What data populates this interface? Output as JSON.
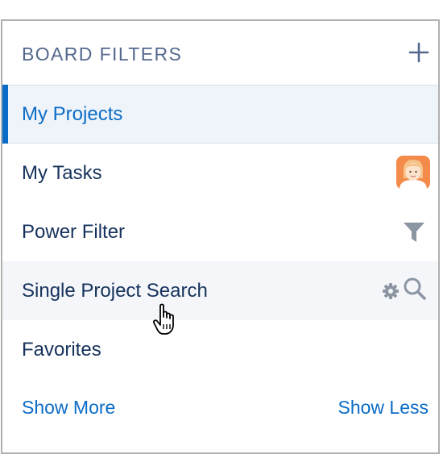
{
  "header": {
    "title": "BOARD FILTERS",
    "add_icon": "plus-icon"
  },
  "filters": [
    {
      "label": "My Projects",
      "state": "selected"
    },
    {
      "label": "My Tasks",
      "icon": "user-avatar"
    },
    {
      "label": "Power Filter",
      "icon": "funnel-icon"
    },
    {
      "label": "Single Project Search",
      "state": "hovered",
      "icons": [
        "gear-icon",
        "search-icon"
      ]
    },
    {
      "label": "Favorites"
    }
  ],
  "footer": {
    "show_more": "Show More",
    "show_less": "Show Less"
  },
  "colors": {
    "accent": "#0b6cc7",
    "text": "#16325c",
    "header_text": "#54698d",
    "selected_bg": "#eef4fa",
    "hover_bg": "#f4f6f9",
    "icon_gray": "#8c96a3"
  }
}
